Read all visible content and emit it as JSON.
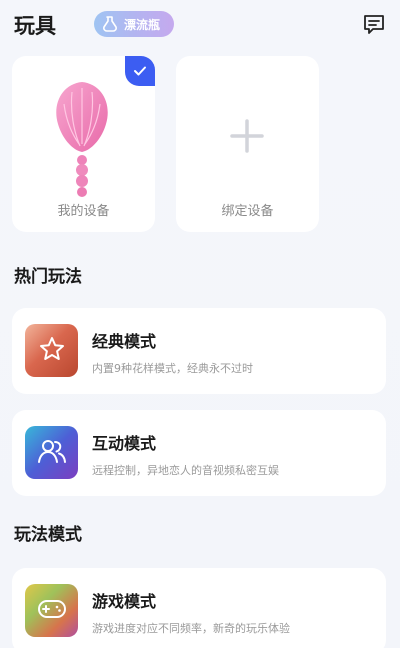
{
  "header": {
    "title": "玩具",
    "bottle_label": "漂流瓶"
  },
  "devices": {
    "mine_label": "我的设备",
    "bind_label": "绑定设备"
  },
  "sections": {
    "hot": "热门玩法",
    "modes": "玩法模式"
  },
  "modes": [
    {
      "name": "经典模式",
      "desc": "内置9种花样模式，经典永不过时",
      "icon": "star-icon"
    },
    {
      "name": "互动模式",
      "desc": "远程控制，异地恋人的音视频私密互娱",
      "icon": "people-icon"
    },
    {
      "name": "游戏模式",
      "desc": "游戏进度对应不同频率，新奇的玩乐体验",
      "icon": "gamepad-icon"
    }
  ],
  "colors": {
    "accent": "#3c5df2",
    "background": "#f4f6fb",
    "card": "#ffffff"
  }
}
